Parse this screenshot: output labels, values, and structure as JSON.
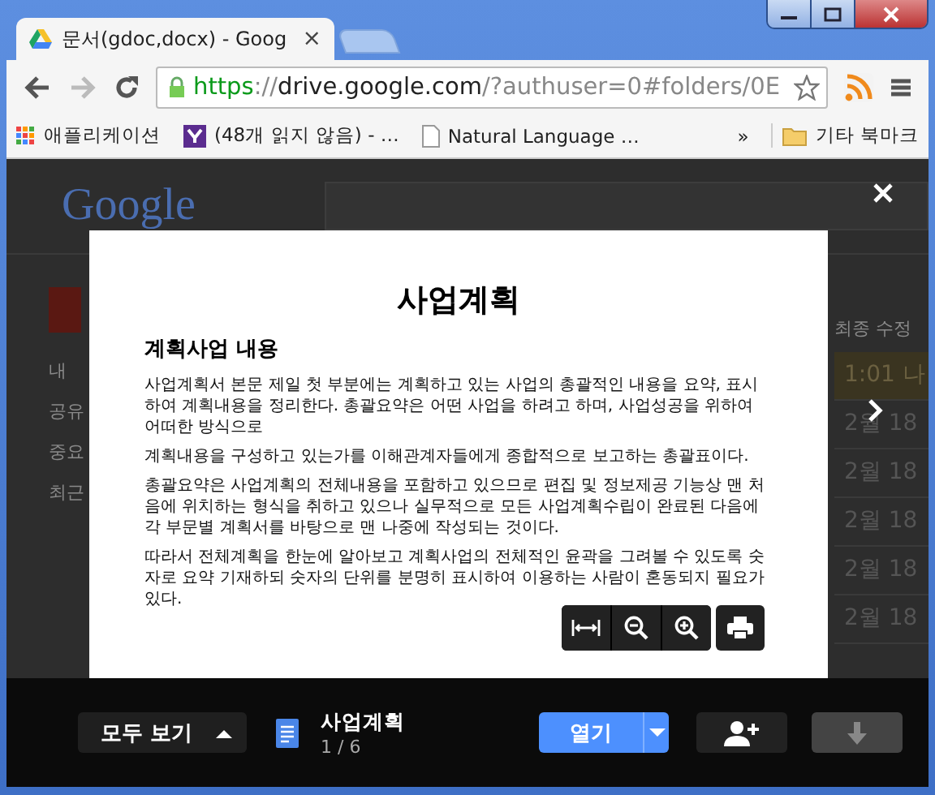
{
  "browser": {
    "tabs": [
      {
        "title": "문서(gdoc,docx) - Goog",
        "selected": true,
        "close": "×"
      },
      {
        "selected": false
      }
    ],
    "url": [
      {
        "kind": "scheme",
        "text": "https"
      },
      {
        "kind": "dim",
        "text": "://"
      },
      {
        "kind": "host",
        "text": "drive.google.com"
      },
      {
        "kind": "dim",
        "text": "/?authuser=0#folders/0E"
      }
    ],
    "bookmarks": [
      {
        "kind": "apps",
        "label": "애플리케이션"
      },
      {
        "kind": "yahoo",
        "label": "(48개 읽지 않음) - …"
      },
      {
        "kind": "page",
        "label": "Natural Language …"
      }
    ],
    "overflow": "»",
    "other_bookmarks": "기타 북마크"
  },
  "backdrop": {
    "logo": "Google",
    "left_items": [
      "내",
      "공유",
      "중요",
      "최근"
    ],
    "column_header": "최종 수정",
    "rows": [
      {
        "text": "1:01 나",
        "selected": true
      },
      {
        "text": "2월 18",
        "selected": false
      },
      {
        "text": "2월 18",
        "selected": false
      },
      {
        "text": "2월 18",
        "selected": false
      },
      {
        "text": "2월 18",
        "selected": false
      },
      {
        "text": "2월 18",
        "selected": false
      }
    ]
  },
  "viewer": {
    "document": {
      "title": "사업계획",
      "heading": "계획사업 내용",
      "paragraphs": [
        "사업계획서 본문 제일 첫 부분에는 계획하고 있는 사업의 총괄적인 내용을 요약, 표시하여 계획내용을 정리한다. 총괄요약은 어떤 사업을 하려고 하며, 사업성공을 위하여 어떠한 방식으로",
        "계획내용을 구성하고 있는가를 이해관계자들에게 종합적으로 보고하는 총괄표이다.",
        "총괄요약은 사업계획의 전체내용을 포함하고 있으므로 편집 및 정보제공 기능상 맨 처음에 위치하는 형식을 취하고 있으나 실무적으로 모든 사업계획수립이 완료된 다음에 각 부문별 계획서를 바탕으로 맨 나중에 작성되는 것이다.",
        "따라서 전체계획을 한눈에 알아보고 계획사업의 전체적인 윤곽을 그려볼 수 있도록 숫자로 요약 기재하되 숫자의 단위를 분명히 표시하여 이용하는 사람이 혼동되지 필요가 있다."
      ]
    },
    "show_all": "모두 보기",
    "file_name": "사업계획",
    "page_count": "1 / 6",
    "open_button": "열기",
    "download_disabled": true
  }
}
